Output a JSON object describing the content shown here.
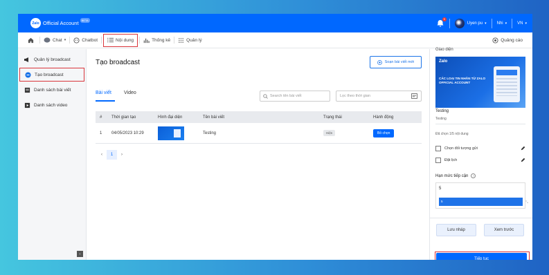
{
  "app": {
    "logo_badge": "Zalo",
    "logo_text": "Official Account",
    "beta_badge": "BETA"
  },
  "topbar": {
    "notification_count": "9",
    "user_name": "Uyen pu",
    "account": "Nhi",
    "language": "VN"
  },
  "nav": {
    "items": [
      {
        "label": "Chat",
        "icon": "chat-icon"
      },
      {
        "label": "Chatbot",
        "icon": "chatbot-icon"
      },
      {
        "label": "Nội dung",
        "icon": "list-icon"
      },
      {
        "label": "Thống kê",
        "icon": "bar-chart-icon"
      },
      {
        "label": "Quản lý",
        "icon": "grid-icon"
      }
    ],
    "ads_label": "Quảng cáo"
  },
  "sidebar": {
    "items": [
      {
        "label": "Quản lý broadcast",
        "icon": "megaphone-icon"
      },
      {
        "label": "Tạo broadcast",
        "icon": "minus-circle-icon"
      },
      {
        "label": "Danh sách bài viết",
        "icon": "article-icon"
      },
      {
        "label": "Danh sách video",
        "icon": "video-icon"
      }
    ],
    "collapse_glyph": "‹"
  },
  "main": {
    "title": "Tạo broadcast",
    "compose_button": "Soạn bài viết mới",
    "tabs": [
      "Bài viết",
      "Video"
    ],
    "search_placeholder": "Search tên bài viết",
    "date_filter_placeholder": "Lọc theo thời gian",
    "table": {
      "headers": [
        "#",
        "Thời gian tạo",
        "Hình đại diện",
        "Tên bài viết",
        "Trạng thái",
        "Hành động"
      ],
      "rows": [
        {
          "index": "1",
          "created": "04/05/2023 10:29",
          "name": "Testing",
          "status": "Hiện",
          "action": "Bỏ chọn"
        }
      ]
    },
    "pagination": {
      "current": "1"
    }
  },
  "right_panel": {
    "heading": "Giao diện",
    "banner": {
      "logo": "Zalo",
      "text": "CÁC LOẠI TIN NHẮN TỪ ZALO OFFICIAL ACCOUNT"
    },
    "article_title": "Testing",
    "article_sub": "Testing",
    "selected_count": "Đã chọn 1/5 nội dung",
    "options": [
      "Chọn đối tượng gửi",
      "Đặt lịch"
    ],
    "reach_title": "Hạn mức tiếp cận",
    "reach_value": "5",
    "reach_bar_value": "5",
    "draft_button": "Lưu nháp",
    "preview_button": "Xem trước",
    "continue_button": "Tiếp tục"
  },
  "colors": {
    "primary": "#0068ff",
    "highlight_outline": "#d9343a"
  }
}
